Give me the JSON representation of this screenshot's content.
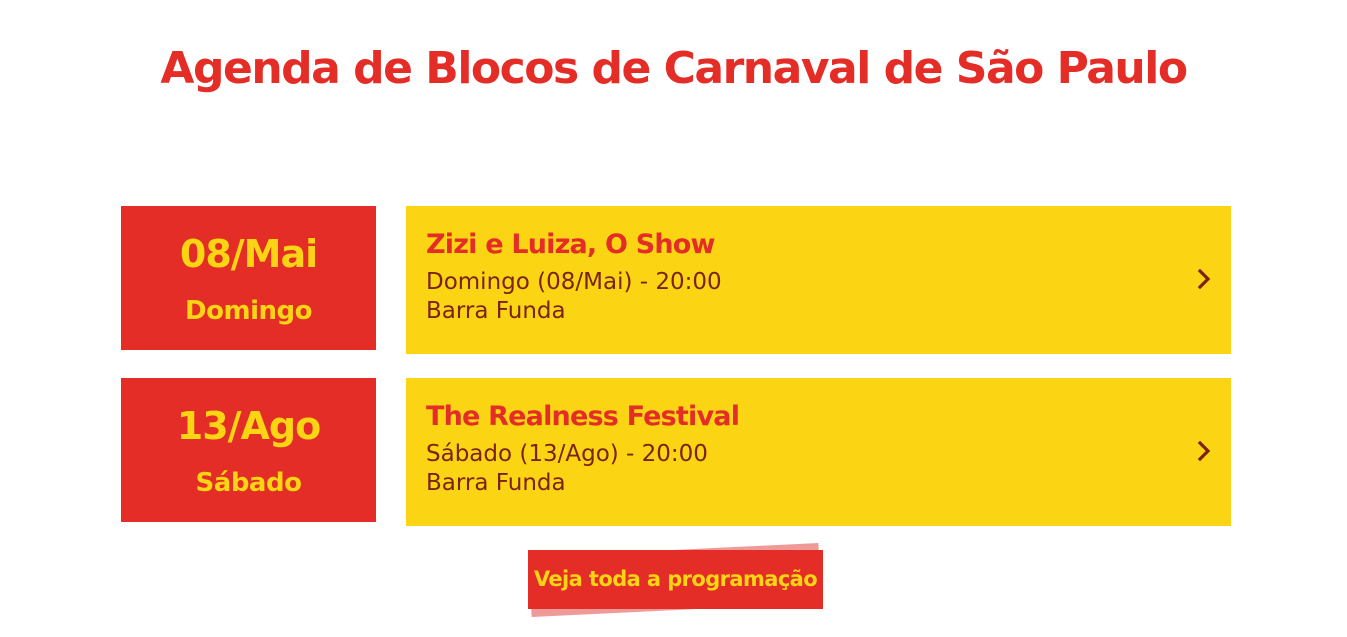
{
  "page": {
    "title": "Agenda de Blocos de Carnaval de São Paulo"
  },
  "events": [
    {
      "date": "08/Mai",
      "weekday": "Domingo",
      "name": "Zizi e Luiza, O Show",
      "when": "Domingo (08/Mai) - 20:00",
      "where": "Barra Funda",
      "icon": "chevron-right-icon"
    },
    {
      "date": "13/Ago",
      "weekday": "Sábado",
      "name": "The Realness Festival",
      "when": "Sábado (13/Ago) - 20:00",
      "where": "Barra Funda",
      "icon": "chevron-right-icon"
    }
  ],
  "cta": {
    "label": "Veja toda a programação"
  },
  "colors": {
    "red": "#e32d26",
    "yellow": "#fbd413",
    "text_brown": "#7a2313",
    "shadow_pink": "#ee9a98"
  }
}
